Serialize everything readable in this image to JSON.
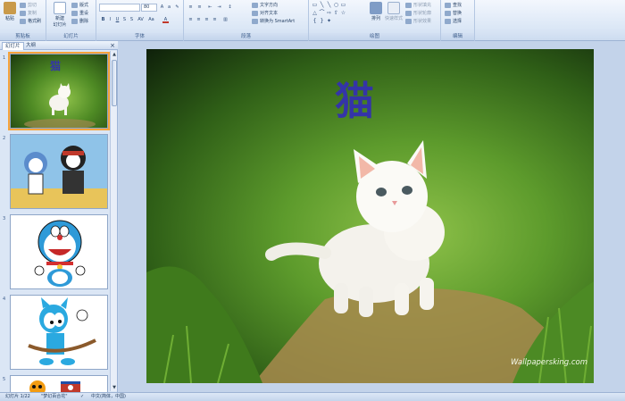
{
  "ribbon": {
    "clipboard": {
      "label": "剪贴板",
      "paste": "粘贴",
      "cut": "剪切",
      "copy": "复制",
      "format_painter": "格式刷"
    },
    "slides": {
      "label": "幻灯片",
      "new_slide": "新建\n幻灯片",
      "layout": "版式",
      "reset": "重设",
      "delete": "删除"
    },
    "font": {
      "label": "字体",
      "font_name": "",
      "font_size": "80"
    },
    "paragraph": {
      "label": "段落",
      "text_direction": "文字方向",
      "align_text": "对齐文本",
      "smartart": "转换为 SmartArt"
    },
    "drawing": {
      "label": "绘图",
      "arrange": "排列",
      "quick_styles": "快速样式",
      "shape_fill": "形状填充",
      "shape_outline": "形状轮廓",
      "shape_effects": "形状效果"
    },
    "editing": {
      "label": "编辑",
      "find": "查找",
      "replace": "替换",
      "select": "选择"
    }
  },
  "pane": {
    "tabs": [
      "幻灯片",
      "大纲"
    ],
    "slides": [
      {
        "num": "1",
        "mini_title": "猫"
      },
      {
        "num": "2"
      },
      {
        "num": "3"
      },
      {
        "num": "4"
      },
      {
        "num": "5"
      }
    ]
  },
  "slide": {
    "title": "猫",
    "watermark": "Wallpapersking.com"
  },
  "status": {
    "slide_info": "幻灯片 1/22",
    "theme": "\"梦幻百合花\"",
    "language": "中文(简体，中国)"
  },
  "colors": {
    "accent": "#3434a8",
    "ribbon": "#dbe7f6",
    "selection": "#f6a33a"
  }
}
